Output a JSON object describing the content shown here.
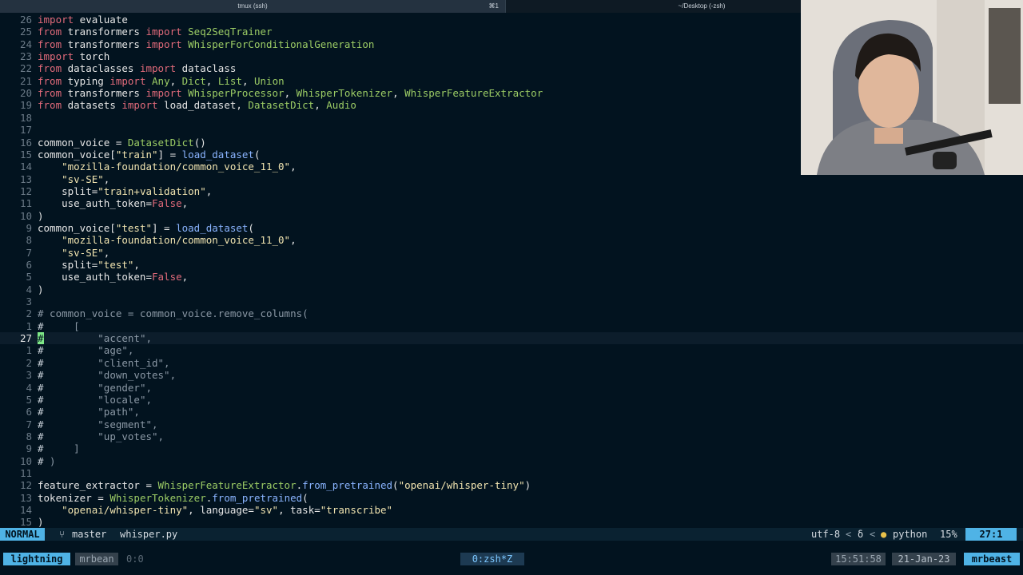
{
  "tabs": [
    {
      "title": "tmux (ssh)",
      "shortcut": "⌘1"
    },
    {
      "title": "~/Desktop (-zsh)"
    }
  ],
  "editor": {
    "lines": [
      {
        "num": "26",
        "code": [
          {
            "t": "import",
            "c": "kw"
          },
          {
            "t": " evaluate"
          }
        ]
      },
      {
        "num": "25",
        "code": [
          {
            "t": "from",
            "c": "kw"
          },
          {
            "t": " transformers "
          },
          {
            "t": "import",
            "c": "kw"
          },
          {
            "t": " "
          },
          {
            "t": "Seq2SeqTrainer",
            "c": "cls"
          }
        ]
      },
      {
        "num": "24",
        "code": [
          {
            "t": "from",
            "c": "kw"
          },
          {
            "t": " transformers "
          },
          {
            "t": "import",
            "c": "kw"
          },
          {
            "t": " "
          },
          {
            "t": "WhisperForConditionalGeneration",
            "c": "cls"
          }
        ]
      },
      {
        "num": "23",
        "code": [
          {
            "t": "import",
            "c": "kw"
          },
          {
            "t": " torch"
          }
        ]
      },
      {
        "num": "22",
        "code": [
          {
            "t": "from",
            "c": "kw"
          },
          {
            "t": " dataclasses "
          },
          {
            "t": "import",
            "c": "kw"
          },
          {
            "t": " dataclass"
          }
        ]
      },
      {
        "num": "21",
        "code": [
          {
            "t": "from",
            "c": "kw"
          },
          {
            "t": " typing "
          },
          {
            "t": "import",
            "c": "kw"
          },
          {
            "t": " "
          },
          {
            "t": "Any",
            "c": "cls"
          },
          {
            "t": ", "
          },
          {
            "t": "Dict",
            "c": "cls"
          },
          {
            "t": ", "
          },
          {
            "t": "List",
            "c": "cls"
          },
          {
            "t": ", "
          },
          {
            "t": "Union",
            "c": "cls"
          }
        ]
      },
      {
        "num": "20",
        "code": [
          {
            "t": "from",
            "c": "kw"
          },
          {
            "t": " transformers "
          },
          {
            "t": "import",
            "c": "kw"
          },
          {
            "t": " "
          },
          {
            "t": "WhisperProcessor",
            "c": "cls"
          },
          {
            "t": ", "
          },
          {
            "t": "WhisperTokenizer",
            "c": "cls"
          },
          {
            "t": ", "
          },
          {
            "t": "WhisperFeatureExtractor",
            "c": "cls"
          }
        ]
      },
      {
        "num": "19",
        "code": [
          {
            "t": "from",
            "c": "kw"
          },
          {
            "t": " datasets "
          },
          {
            "t": "import",
            "c": "kw"
          },
          {
            "t": " load_dataset, "
          },
          {
            "t": "DatasetDict",
            "c": "cls"
          },
          {
            "t": ", "
          },
          {
            "t": "Audio",
            "c": "cls"
          }
        ]
      },
      {
        "num": "18",
        "code": []
      },
      {
        "num": "17",
        "code": []
      },
      {
        "num": "16",
        "code": [
          {
            "t": "common_voice = "
          },
          {
            "t": "DatasetDict",
            "c": "cls"
          },
          {
            "t": "()"
          }
        ]
      },
      {
        "num": "15",
        "code": [
          {
            "t": "common_voice["
          },
          {
            "t": "\"train\"",
            "c": "str"
          },
          {
            "t": "] = "
          },
          {
            "t": "load_dataset",
            "c": "fn"
          },
          {
            "t": "("
          }
        ]
      },
      {
        "num": "14",
        "code": [
          {
            "t": "    "
          },
          {
            "t": "\"mozilla-foundation/common_voice_11_0\"",
            "c": "str"
          },
          {
            "t": ","
          }
        ]
      },
      {
        "num": "13",
        "code": [
          {
            "t": "    "
          },
          {
            "t": "\"sv-SE\"",
            "c": "str"
          },
          {
            "t": ","
          }
        ]
      },
      {
        "num": "12",
        "code": [
          {
            "t": "    split="
          },
          {
            "t": "\"train+validation\"",
            "c": "str"
          },
          {
            "t": ","
          }
        ]
      },
      {
        "num": "11",
        "code": [
          {
            "t": "    use_auth_token="
          },
          {
            "t": "False",
            "c": "kw"
          },
          {
            "t": ","
          }
        ]
      },
      {
        "num": "10",
        "code": [
          {
            "t": ")"
          }
        ]
      },
      {
        "num": "9",
        "code": [
          {
            "t": "common_voice["
          },
          {
            "t": "\"test\"",
            "c": "str"
          },
          {
            "t": "] = "
          },
          {
            "t": "load_dataset",
            "c": "fn"
          },
          {
            "t": "("
          }
        ]
      },
      {
        "num": "8",
        "code": [
          {
            "t": "    "
          },
          {
            "t": "\"mozilla-foundation/common_voice_11_0\"",
            "c": "str"
          },
          {
            "t": ","
          }
        ]
      },
      {
        "num": "7",
        "code": [
          {
            "t": "    "
          },
          {
            "t": "\"sv-SE\"",
            "c": "str"
          },
          {
            "t": ","
          }
        ]
      },
      {
        "num": "6",
        "code": [
          {
            "t": "    split="
          },
          {
            "t": "\"test\"",
            "c": "str"
          },
          {
            "t": ","
          }
        ]
      },
      {
        "num": "5",
        "code": [
          {
            "t": "    use_auth_token="
          },
          {
            "t": "False",
            "c": "kw"
          },
          {
            "t": ","
          }
        ]
      },
      {
        "num": "4",
        "code": [
          {
            "t": ")"
          }
        ]
      },
      {
        "num": "3",
        "code": []
      },
      {
        "num": "2",
        "code": [
          {
            "t": "# common_voice = common_voice.remove_columns(",
            "c": "com"
          }
        ]
      },
      {
        "num": "1",
        "code": [
          {
            "t": "#",
            "c": "cmt-hash"
          },
          {
            "t": "     [",
            "c": "com"
          }
        ]
      },
      {
        "num": "27",
        "current": true,
        "code": [
          {
            "t": "#",
            "c": "cursor"
          },
          {
            "t": "         \"accent\",",
            "c": "com"
          }
        ]
      },
      {
        "num": "1",
        "code": [
          {
            "t": "#",
            "c": "cmt-hash"
          },
          {
            "t": "         \"age\",",
            "c": "com"
          }
        ]
      },
      {
        "num": "2",
        "code": [
          {
            "t": "#",
            "c": "cmt-hash"
          },
          {
            "t": "         \"client_id\",",
            "c": "com"
          }
        ]
      },
      {
        "num": "3",
        "code": [
          {
            "t": "#",
            "c": "cmt-hash"
          },
          {
            "t": "         \"down_votes\",",
            "c": "com"
          }
        ]
      },
      {
        "num": "4",
        "code": [
          {
            "t": "#",
            "c": "cmt-hash"
          },
          {
            "t": "         \"gender\",",
            "c": "com"
          }
        ]
      },
      {
        "num": "5",
        "code": [
          {
            "t": "#",
            "c": "cmt-hash"
          },
          {
            "t": "         \"locale\",",
            "c": "com"
          }
        ]
      },
      {
        "num": "6",
        "code": [
          {
            "t": "#",
            "c": "cmt-hash"
          },
          {
            "t": "         \"path\",",
            "c": "com"
          }
        ]
      },
      {
        "num": "7",
        "code": [
          {
            "t": "#",
            "c": "cmt-hash"
          },
          {
            "t": "         \"segment\",",
            "c": "com"
          }
        ]
      },
      {
        "num": "8",
        "code": [
          {
            "t": "#",
            "c": "cmt-hash"
          },
          {
            "t": "         \"up_votes\",",
            "c": "com"
          }
        ]
      },
      {
        "num": "9",
        "code": [
          {
            "t": "#",
            "c": "cmt-hash"
          },
          {
            "t": "     ]",
            "c": "com"
          }
        ]
      },
      {
        "num": "10",
        "code": [
          {
            "t": "#",
            "c": "cmt-hash"
          },
          {
            "t": " )",
            "c": "com"
          }
        ]
      },
      {
        "num": "11",
        "code": []
      },
      {
        "num": "12",
        "code": [
          {
            "t": "feature_extractor = "
          },
          {
            "t": "WhisperFeatureExtractor",
            "c": "cls"
          },
          {
            "t": "."
          },
          {
            "t": "from_pretrained",
            "c": "fn"
          },
          {
            "t": "("
          },
          {
            "t": "\"openai/whisper-tiny\"",
            "c": "str"
          },
          {
            "t": ")"
          }
        ]
      },
      {
        "num": "13",
        "code": [
          {
            "t": "tokenizer = "
          },
          {
            "t": "WhisperTokenizer",
            "c": "cls"
          },
          {
            "t": "."
          },
          {
            "t": "from_pretrained",
            "c": "fn"
          },
          {
            "t": "("
          }
        ]
      },
      {
        "num": "14",
        "code": [
          {
            "t": "    "
          },
          {
            "t": "\"openai/whisper-tiny\"",
            "c": "str"
          },
          {
            "t": ", language="
          },
          {
            "t": "\"sv\"",
            "c": "str"
          },
          {
            "t": ", task="
          },
          {
            "t": "\"transcribe\"",
            "c": "str"
          }
        ]
      },
      {
        "num": "15",
        "code": [
          {
            "t": ")"
          }
        ]
      }
    ]
  },
  "statusline": {
    "mode": "NORMAL",
    "branch_icon": "git-branch-icon",
    "branch": "master",
    "file": "whisper.py",
    "encoding": "utf-8",
    "delta": "δ",
    "lang_icon": "python-icon",
    "language": "python",
    "percent": "15%",
    "position": "27:1"
  },
  "tmux": {
    "session": "lightning",
    "user": "mrbean",
    "pane": "0:0",
    "window": "0:zsh*Z",
    "time": "15:51:58",
    "date": "21-Jan-23",
    "host": "mrbeast"
  },
  "colors": {
    "background": "#02131f",
    "mode_bg": "#4fb3e6",
    "keyword": "#e16a7a",
    "class": "#9ccc65",
    "function": "#8ab4ff",
    "string": "#f1e4b0",
    "cursor": "#7ee787"
  }
}
